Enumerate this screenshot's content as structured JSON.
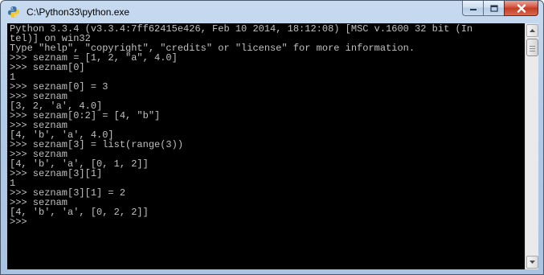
{
  "window": {
    "title": "C:\\Python33\\python.exe"
  },
  "icons": {
    "app": "python-icon",
    "minimize": "minimize-icon",
    "maximize": "maximize-icon",
    "close": "close-icon",
    "scroll_up": "arrow-up-icon",
    "scroll_down": "arrow-down-icon"
  },
  "colors": {
    "console_background": "#000000",
    "console_text": "#c0c0c0",
    "close_button": "#c23b22",
    "titlebar": "#b3cbe6"
  },
  "console": {
    "lines": [
      "Python 3.3.4 (v3.3.4:7ff62415e426, Feb 10 2014, 18:12:08) [MSC v.1600 32 bit (In",
      "tel)] on win32",
      "Type \"help\", \"copyright\", \"credits\" or \"license\" for more information.",
      ">>> seznam = [1, 2, \"a\", 4.0]",
      ">>> seznam[0]",
      "1",
      ">>> seznam[0] = 3",
      ">>> seznam",
      "[3, 2, 'a', 4.0]",
      ">>> seznam[0:2] = [4, \"b\"]",
      ">>> seznam",
      "[4, 'b', 'a', 4.0]",
      ">>> seznam[3] = list(range(3))",
      ">>> seznam",
      "[4, 'b', 'a', [0, 1, 2]]",
      ">>> seznam[3][1]",
      "1",
      ">>> seznam[3][1] = 2",
      ">>> seznam",
      "[4, 'b', 'a', [0, 2, 2]]",
      ">>>"
    ]
  }
}
